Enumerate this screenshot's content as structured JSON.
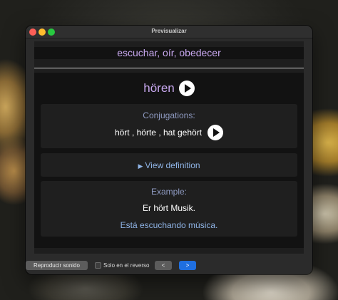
{
  "window": {
    "title": "Previsualizar"
  },
  "card": {
    "front": "escuchar, oír, obedecer",
    "word": "hören",
    "conjugations_label": "Conjugations:",
    "conjugations": "hört , hörte , hat gehört",
    "definition_link": "View definition",
    "example_label": "Example:",
    "example_de": "Er hört Musik.",
    "example_es": "Está escuchando música."
  },
  "footer": {
    "play_sound": "Reproducir sonido",
    "back_only": "Solo en el reverso",
    "back_only_checked": false,
    "prev": "<",
    "next": ">"
  },
  "icons": {
    "play": "play-icon",
    "disclosure": "triangle-right-icon"
  },
  "colors": {
    "word": "#c8a8ef",
    "label": "#8f9bc2",
    "link": "#8fb4e6",
    "next_button": "#1f6fe0"
  }
}
